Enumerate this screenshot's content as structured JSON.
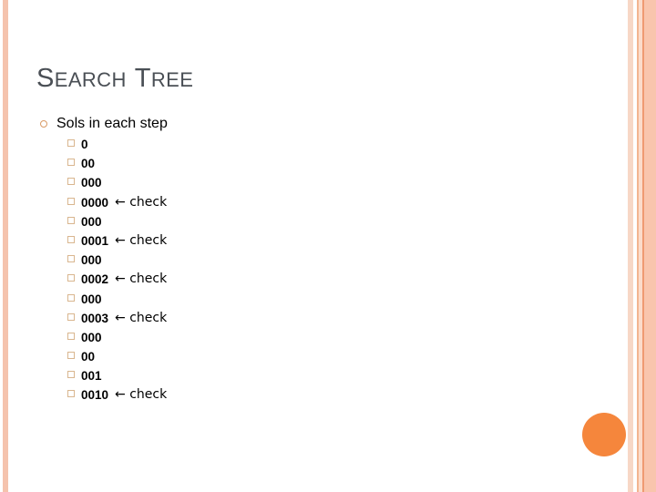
{
  "slide": {
    "title": {
      "full_text": "SEARCH TREE",
      "word1_cap": "S",
      "word1_rest": "EARCH",
      "word2_cap": "T",
      "word2_rest": "REE"
    },
    "content": {
      "level1_text": "Sols in each step",
      "items": [
        {
          "value": "0",
          "annotation": ""
        },
        {
          "value": "00",
          "annotation": ""
        },
        {
          "value": "000",
          "annotation": ""
        },
        {
          "value": "0000",
          "annotation": "← check"
        },
        {
          "value": "000",
          "annotation": ""
        },
        {
          "value": "0001",
          "annotation": "← check"
        },
        {
          "value": "000",
          "annotation": ""
        },
        {
          "value": "0002",
          "annotation": "← check"
        },
        {
          "value": "000",
          "annotation": ""
        },
        {
          "value": "0003",
          "annotation": "← check"
        },
        {
          "value": "000",
          "annotation": ""
        },
        {
          "value": "00",
          "annotation": ""
        },
        {
          "value": "001",
          "annotation": ""
        },
        {
          "value": "0010",
          "annotation": "← check"
        }
      ]
    },
    "decor": {
      "left_stripe_color": "#f5c3ad",
      "right_stripe_colors": [
        "#f7d7c6",
        "#f3b591",
        "#fbdccb",
        "#ef9a72",
        "#f9c5ad"
      ],
      "accent_circle_color": "#f5863c",
      "title_color": "#4a4f55",
      "level1_bullet_color": "#d99a66",
      "level2_bullet_color": "#d9b68f"
    }
  }
}
